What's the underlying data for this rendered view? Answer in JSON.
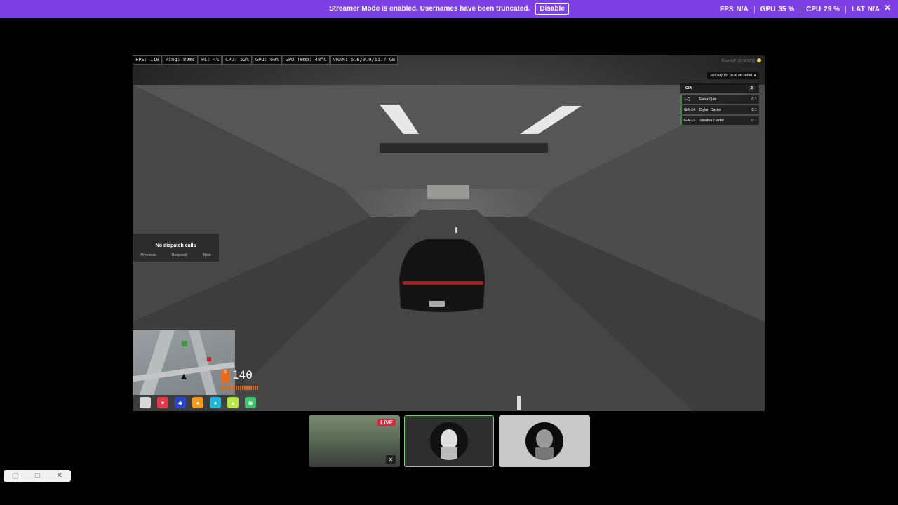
{
  "banner": {
    "message": "Streamer Mode is enabled. Usernames have been truncated.",
    "button": "Disable",
    "stats": [
      {
        "label": "FPS",
        "value": "N/A"
      },
      {
        "label": "GPU",
        "value": "35 %"
      },
      {
        "label": "CPU",
        "value": "29 %"
      },
      {
        "label": "LAT",
        "value": "N/A"
      }
    ],
    "color": "#7b3fe4"
  },
  "game": {
    "perf": [
      "FPS: 110",
      "Ping: 89ms",
      "PL: 4%",
      "CPU: 52%",
      "GPU: 60%",
      "GPU Temp: 48°C",
      "VRAM: 5.6/9.9/11.7 GB"
    ],
    "client_tag": "FiveM* (b3095)",
    "datetime": "January 19, 2026 06:38PM",
    "scoreboard": {
      "title": "CIA",
      "count": "3",
      "rows": [
        {
          "tag": "1-Q",
          "name": "Eslar Qab",
          "score": "0.1"
        },
        {
          "tag": "GA-14",
          "name": "Dylan Carter",
          "score": "0.1"
        },
        {
          "tag": "GA-13",
          "name": "Sinaloa Cartel",
          "score": "0.1"
        }
      ]
    },
    "dispatch": {
      "title": "No dispatch calls",
      "actions": [
        "Previous",
        "Respond",
        "Next"
      ]
    },
    "speed": "140",
    "gear": "3"
  },
  "thumbnails": {
    "live_badge": "LIVE"
  }
}
